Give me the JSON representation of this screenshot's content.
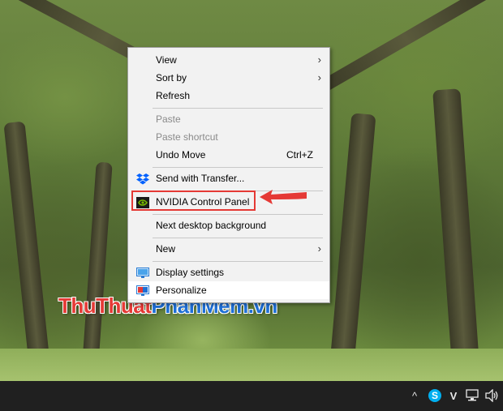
{
  "context_menu": {
    "items": [
      {
        "label": "View",
        "has_submenu": true
      },
      {
        "label": "Sort by",
        "has_submenu": true
      },
      {
        "label": "Refresh"
      },
      {
        "label": "Paste",
        "disabled": true
      },
      {
        "label": "Paste shortcut",
        "disabled": true
      },
      {
        "label": "Undo Move",
        "shortcut": "Ctrl+Z"
      },
      {
        "label": "Send with Transfer...",
        "icon": "dropbox-icon"
      },
      {
        "label": "NVIDIA Control Panel",
        "icon": "nvidia-icon",
        "highlighted": true
      },
      {
        "label": "Next desktop background"
      },
      {
        "label": "New",
        "has_submenu": true
      },
      {
        "label": "Display settings",
        "icon": "display-settings-icon"
      },
      {
        "label": "Personalize",
        "icon": "personalize-icon",
        "hovered": true
      }
    ],
    "submenu_arrow": "›"
  },
  "watermark": {
    "part1": "ThuThuat",
    "part2": "PhanMem",
    "part3": ".vn"
  },
  "taskbar": {
    "tray_icons": [
      "chevron-up-icon",
      "skype-icon",
      "vectr-icon",
      "network-icon",
      "volume-icon"
    ],
    "chevron": "^",
    "skype": "S",
    "vectr": "V"
  },
  "colors": {
    "highlight_box": "#e53935",
    "arrow": "#e53935",
    "watermark_red": "#e53935",
    "watermark_blue": "#1e6fd6",
    "taskbar": "#202020",
    "menu_bg": "#f2f2f2"
  }
}
